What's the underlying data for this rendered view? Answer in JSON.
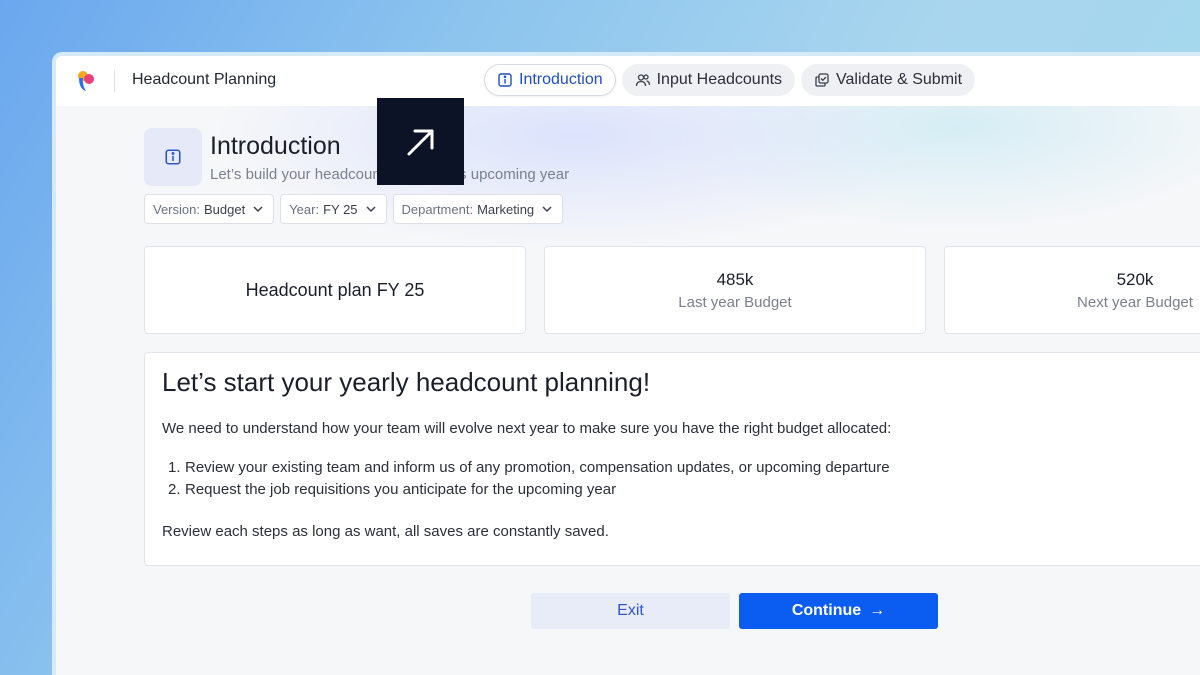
{
  "header": {
    "app_title": "Headcount Planning",
    "tabs": [
      {
        "label": "Introduction",
        "icon": "info-icon",
        "active": true
      },
      {
        "label": "Input Headcounts",
        "icon": "users-icon",
        "active": false
      },
      {
        "label": "Validate & Submit",
        "icon": "copy-check-icon",
        "active": false
      }
    ]
  },
  "intro": {
    "title": "Introduction",
    "subtitle": "Let’s build your headcount plan for this upcoming year"
  },
  "filters": [
    {
      "label": "Version:",
      "value": "Budget"
    },
    {
      "label": "Year:",
      "value": "FY 25"
    },
    {
      "label": "Department:",
      "value": "Marketing"
    }
  ],
  "cards": {
    "plan_title": "Headcount plan FY 25",
    "last_year": {
      "value": "485k",
      "label": "Last year Budget"
    },
    "next_year": {
      "value": "520k",
      "label": "Next year Budget"
    }
  },
  "main": {
    "heading": "Let’s start your yearly headcount planning!",
    "paragraph": "We need to understand how your team will evolve next year to make sure you have the right budget allocated:",
    "list": [
      {
        "num": "1.",
        "text": "Review your existing team and inform us of any promotion, compensation updates, or upcoming departure"
      },
      {
        "num": "2.",
        "text": "Request the job requisitions you anticipate for the upcoming year"
      }
    ],
    "footer": "Review each steps as long as want, all saves are constantly saved."
  },
  "actions": {
    "exit_label": "Exit",
    "continue_label": "Continue",
    "continue_arrow": "→"
  },
  "colors": {
    "accent": "#0b5cf0",
    "active_tab_text": "#1f4fc2",
    "overlay": "#0c1327"
  }
}
